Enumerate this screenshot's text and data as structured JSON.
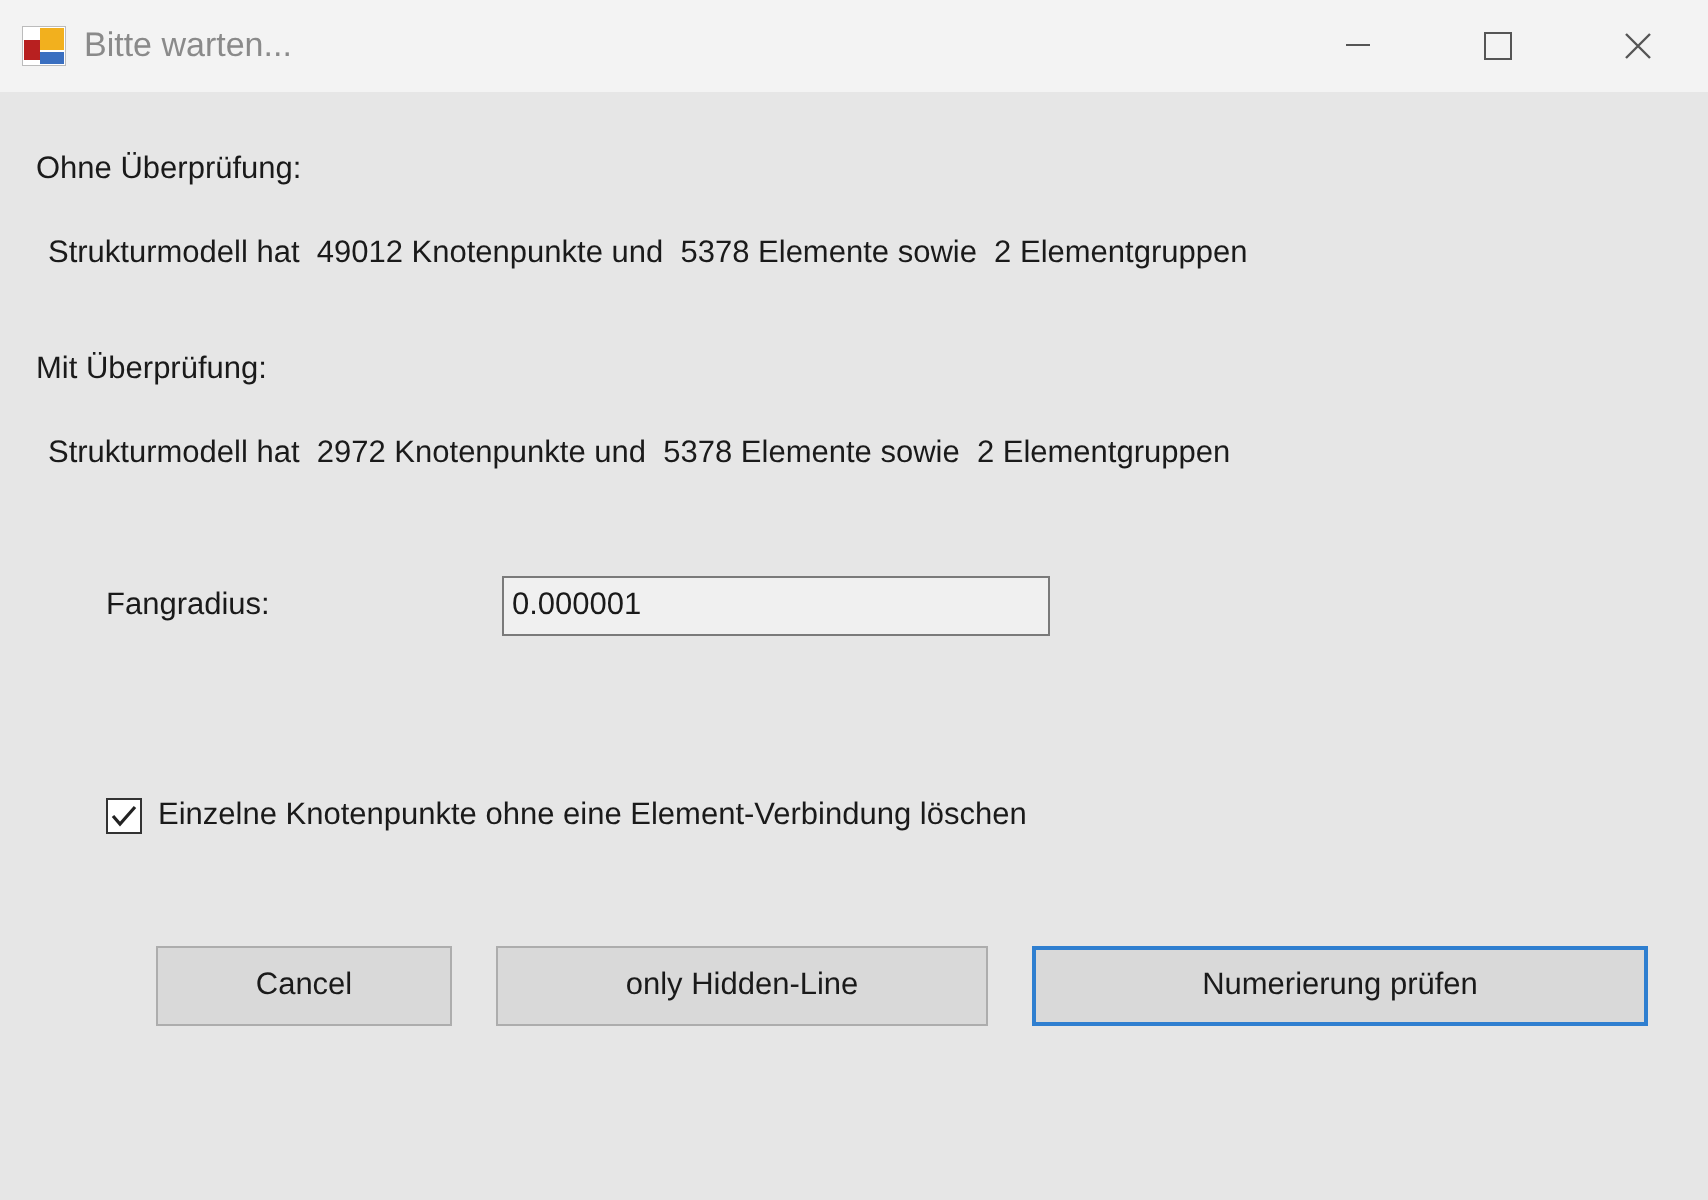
{
  "window": {
    "title": "Bitte warten..."
  },
  "sections": [
    {
      "heading": "Ohne Überprüfung:",
      "summary": "Strukturmodell hat  49012 Knotenpunkte und  5378 Elemente sowie  2 Elementgruppen"
    },
    {
      "heading": "Mit Überprüfung:",
      "summary": "Strukturmodell hat  2972 Knotenpunkte und  5378 Elemente sowie  2 Elementgruppen"
    }
  ],
  "fangradius": {
    "label": "Fangradius:",
    "value": "0.000001"
  },
  "checkbox": {
    "label": "Einzelne Knotenpunkte ohne eine Element-Verbindung löschen",
    "checked": true
  },
  "buttons": [
    {
      "label": "Cancel",
      "focused": false
    },
    {
      "label": "only Hidden-Line",
      "focused": false
    },
    {
      "label": "Numerierung prüfen",
      "focused": true
    }
  ]
}
